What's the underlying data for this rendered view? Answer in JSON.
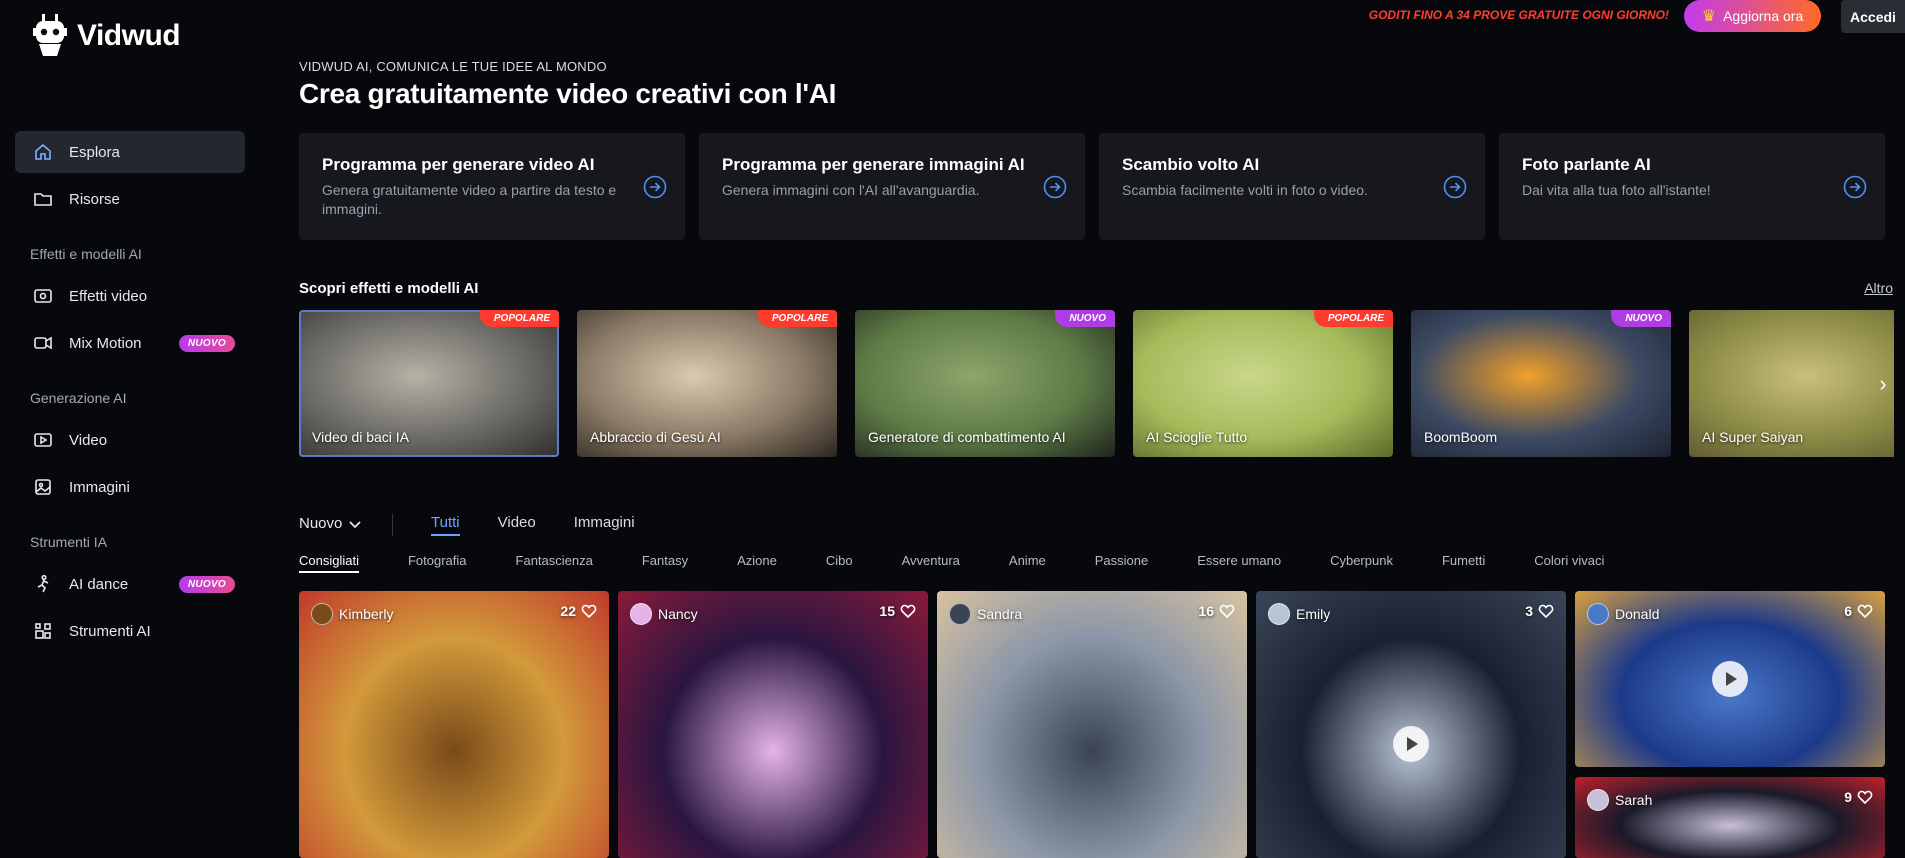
{
  "brand": {
    "name": "Vidwud"
  },
  "topbar": {
    "promo": "GODITI FINO A 34 PROVE GRATUITE OGNI GIORNO!",
    "upgrade_label": "Aggiorna ora",
    "login_label": "Accedi"
  },
  "sidebar": {
    "main": [
      {
        "label": "Esplora",
        "icon": "home-icon"
      },
      {
        "label": "Risorse",
        "icon": "folder-icon"
      }
    ],
    "sections": [
      {
        "title": "Effetti e modelli AI",
        "items": [
          {
            "label": "Effetti video",
            "icon": "video-effect-icon"
          },
          {
            "label": "Mix Motion",
            "icon": "camera-icon",
            "badge": "NUOVO"
          }
        ]
      },
      {
        "title": "Generazione AI",
        "items": [
          {
            "label": "Video",
            "icon": "play-box-icon"
          },
          {
            "label": "Immagini",
            "icon": "image-icon"
          }
        ]
      },
      {
        "title": "Strumenti IA",
        "items": [
          {
            "label": "AI dance",
            "icon": "dance-icon",
            "badge": "NUOVO"
          },
          {
            "label": "Strumenti AI",
            "icon": "tools-icon"
          }
        ]
      }
    ]
  },
  "hero": {
    "eyebrow": "VIDWUD AI, COMUNICA LE TUE IDEE AL MONDO",
    "headline": "Crea gratuitamente video creativi con l'AI"
  },
  "cards": [
    {
      "title": "Programma per generare video AI",
      "desc": "Genera gratuitamente video a partire da testo e immagini."
    },
    {
      "title": "Programma per generare immagini AI",
      "desc": "Genera immagini con l'AI all'avanguardia."
    },
    {
      "title": "Scambio volto AI",
      "desc": "Scambia facilmente volti in foto o video."
    },
    {
      "title": "Foto parlante AI",
      "desc": "Dai vita alla tua foto all'istante!"
    }
  ],
  "effects_section": {
    "title": "Scopri effetti e modelli AI",
    "more": "Altro",
    "items": [
      {
        "label": "Video di baci IA",
        "tag": "POPOLARE",
        "tag_type": "pop",
        "colors": [
          "#6b6a66",
          "#b8b2a6",
          "#2e2d2b"
        ]
      },
      {
        "label": "Abbraccio di Gesù AI",
        "tag": "POPOLARE",
        "tag_type": "pop",
        "colors": [
          "#8a7a66",
          "#d9cbb1",
          "#2c2620"
        ]
      },
      {
        "label": "Generatore di combattimento AI",
        "tag": "NUOVO",
        "tag_type": "new",
        "colors": [
          "#5d7a45",
          "#8ea56c",
          "#1f2420"
        ]
      },
      {
        "label": "AI Scioglie Tutto",
        "tag": "POPOLARE",
        "tag_type": "pop",
        "colors": [
          "#a5bb5a",
          "#c9d78a",
          "#5a6a2a"
        ]
      },
      {
        "label": "BoomBoom",
        "tag": "NUOVO",
        "tag_type": "new",
        "colors": [
          "#3c4a63",
          "#f2a02a",
          "#1d2230"
        ]
      },
      {
        "label": "AI Super Saiyan",
        "tag": "",
        "tag_type": "",
        "colors": [
          "#8a8a45",
          "#c9c07a",
          "#5a5030"
        ]
      }
    ]
  },
  "filters": {
    "sort": "Nuovo",
    "types": [
      "Tutti",
      "Video",
      "Immagini"
    ],
    "categories": [
      "Consigliati",
      "Fotografia",
      "Fantascienza",
      "Fantasy",
      "Azione",
      "Cibo",
      "Avventura",
      "Anime",
      "Passione",
      "Essere umano",
      "Cyberpunk",
      "Fumetti",
      "Colori vivaci"
    ]
  },
  "gallery": [
    {
      "user": "Kimberly",
      "likes": "22",
      "colors": [
        "#d29a3a",
        "#7a4a1a",
        "#c0392b"
      ],
      "play": false
    },
    {
      "user": "Nancy",
      "likes": "15",
      "colors": [
        "#2a1640",
        "#e4b3e8",
        "#8a1a3a"
      ],
      "play": false
    },
    {
      "user": "Sandra",
      "likes": "16",
      "colors": [
        "#8a96a8",
        "#3a4452",
        "#d8c2a0"
      ],
      "play": false
    },
    {
      "user": "Emily",
      "likes": "3",
      "colors": [
        "#1a2030",
        "#b8c4d6",
        "#3a4658"
      ],
      "play": true
    },
    {
      "user": "Donald",
      "likes": "6",
      "colors": [
        "#1d3a8a",
        "#4a78c8",
        "#d8a040"
      ],
      "play": true
    },
    {
      "user": "Sarah",
      "likes": "9",
      "colors": [
        "#1a1a2a",
        "#c8c0d8",
        "#c0202a"
      ],
      "play": false
    }
  ]
}
